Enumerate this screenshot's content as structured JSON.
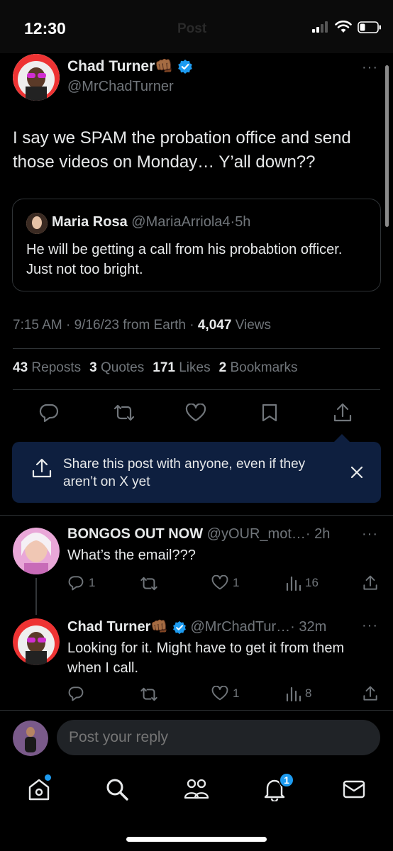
{
  "status_bar": {
    "time": "12:30",
    "header_title": "Post"
  },
  "main_post": {
    "author_name": "Chad Turner",
    "author_emoji": "👊🏾",
    "author_handle": "@MrChadTurner",
    "text": "I say we SPAM the probation office and send those videos on Monday… Y’all down??",
    "quoted": {
      "author_name": "Maria Rosa",
      "author_handle": "@MariaArriola4",
      "separator": "·",
      "time": "5h",
      "text": "He will be getting a call from his probabtion officer. Just not too bright."
    },
    "meta_time": "7:15 AM · 9/16/23 from Earth ·",
    "views_count": "4,047",
    "views_label": "Views",
    "stats": [
      {
        "count": "43",
        "label": "Reposts"
      },
      {
        "count": "3",
        "label": "Quotes"
      },
      {
        "count": "171",
        "label": "Likes"
      },
      {
        "count": "2",
        "label": "Bookmarks"
      }
    ]
  },
  "share_banner": {
    "text": "Share this post with anyone, even if they aren’t on X yet"
  },
  "replies": [
    {
      "author_name": "BONGOS OUT NOW",
      "author_handle": "@yOUR_mot…",
      "meta": "· 2h",
      "text": "What’s the email???",
      "reply_count": "1",
      "like_count": "1",
      "view_count": "16"
    },
    {
      "author_name": "Chad Turner",
      "author_emoji": "👊🏾",
      "author_handle": "@MrChadTur…",
      "meta": "· 32m",
      "text": "Looking for it. Might have to get it from them when I call.",
      "like_count": "1",
      "view_count": "8"
    }
  ],
  "composer": {
    "placeholder": "Post your reply"
  },
  "bottom_nav": {
    "notifications_badge": "1"
  },
  "colors": {
    "accent": "#1d9bf0",
    "banner_bg": "#0e1f3f",
    "muted": "#71767b"
  },
  "icons": [
    "search-icon",
    "home-icon",
    "people-icon",
    "bell-icon",
    "mail-icon",
    "reply-icon",
    "repost-icon",
    "heart-icon",
    "bookmark-icon",
    "share-icon",
    "views-icon",
    "close-icon",
    "more-icon",
    "verified-icon"
  ]
}
